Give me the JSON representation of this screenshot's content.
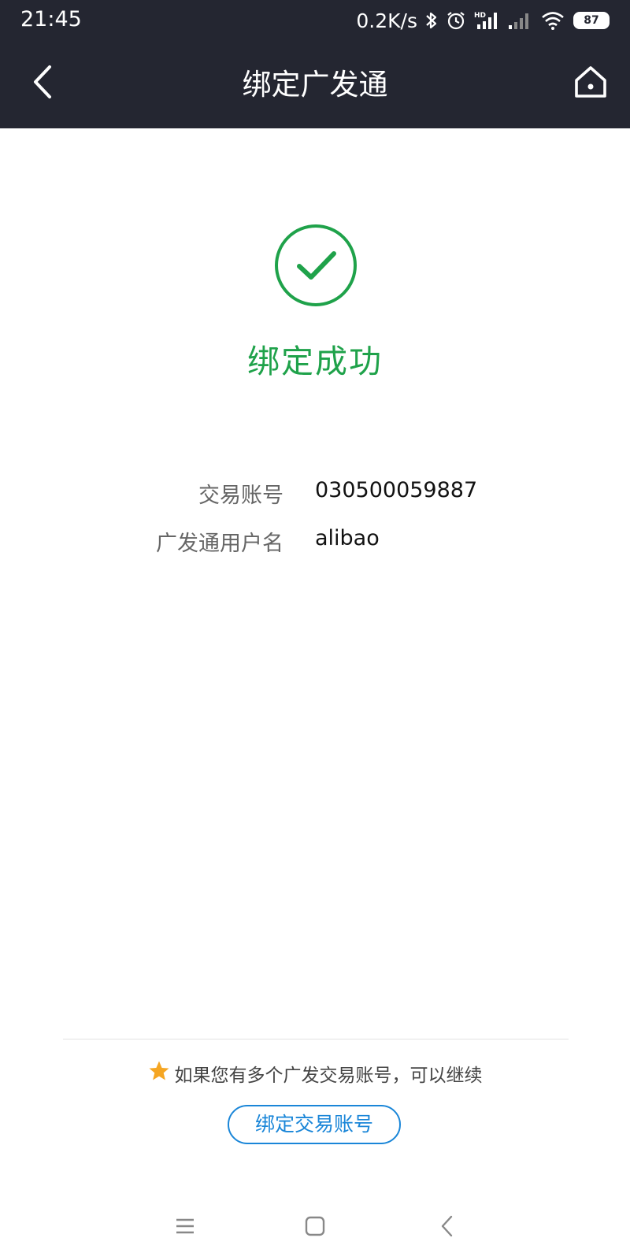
{
  "status_bar": {
    "time": "21:45",
    "net_speed": "0.2K/s",
    "battery": "87",
    "icons": [
      "bluetooth-icon",
      "alarm-icon",
      "hd-signal-icon",
      "signal-icon",
      "wifi-icon",
      "battery-icon"
    ]
  },
  "header": {
    "title": "绑定广发通",
    "back_icon": "chevron-left-icon",
    "home_icon": "home-icon"
  },
  "result": {
    "icon": "check-circle-icon",
    "message": "绑定成功",
    "color": "#1fa24a"
  },
  "details": [
    {
      "label": "交易账号",
      "value": "030500059887"
    },
    {
      "label": "广发通用户名",
      "value": "alibao"
    }
  ],
  "footer": {
    "hint": "如果您有多个广发交易账号，可以继续",
    "hint_icon": "star-icon",
    "button_label": "绑定交易账号",
    "accent_color": "#1a86d8"
  },
  "system_nav": {
    "icons": [
      "menu-icon",
      "home-square-icon",
      "back-icon"
    ]
  },
  "colors": {
    "header_bg": "#242631",
    "star": "#f5a623"
  }
}
